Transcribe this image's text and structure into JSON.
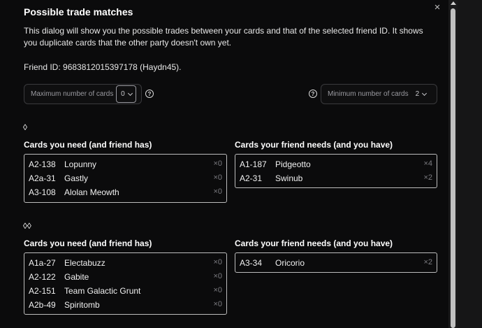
{
  "dialog": {
    "title": "Possible trade matches",
    "close_label": "×",
    "description": "This dialog will show you the possible trades between your cards and that of the selected friend ID. It shows you duplicate cards that the other party doesn't own yet.",
    "friend_id": "Friend ID: 9683812015397178 (Haydn45)."
  },
  "controls": {
    "max_label": "Maximum number of cards",
    "max_value": "0",
    "min_label": "Minimum number of cards",
    "min_value": "2",
    "help_glyph": "?"
  },
  "groups": [
    {
      "symbol": "◊",
      "need_title": "Cards you need (and friend has)",
      "give_title": "Cards your friend needs (and you have)",
      "need": [
        {
          "code": "A2-138",
          "name": "Lopunny",
          "qty": "×0"
        },
        {
          "code": "A2a-31",
          "name": "Gastly",
          "qty": "×0"
        },
        {
          "code": "A3-108",
          "name": "Alolan Meowth",
          "qty": "×0"
        }
      ],
      "give": [
        {
          "code": "A1-187",
          "name": "Pidgeotto",
          "qty": "×4"
        },
        {
          "code": "A2-31",
          "name": "Swinub",
          "qty": "×2"
        }
      ]
    },
    {
      "symbol": "◊◊",
      "need_title": "Cards you need (and friend has)",
      "give_title": "Cards your friend needs (and you have)",
      "need": [
        {
          "code": "A1a-27",
          "name": "Electabuzz",
          "qty": "×0"
        },
        {
          "code": "A2-122",
          "name": "Gabite",
          "qty": "×0"
        },
        {
          "code": "A2-151",
          "name": "Team Galactic Grunt",
          "qty": "×0"
        },
        {
          "code": "A2b-49",
          "name": "Spiritomb",
          "qty": "×0"
        }
      ],
      "give": [
        {
          "code": "A3-34",
          "name": "Oricorio",
          "qty": "×2"
        }
      ]
    }
  ]
}
